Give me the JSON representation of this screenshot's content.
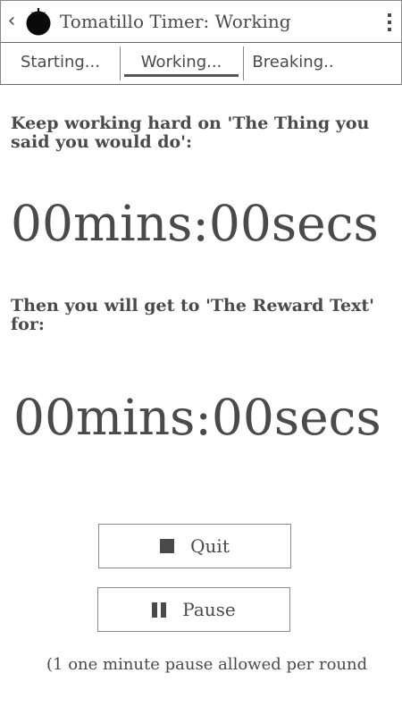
{
  "header": {
    "title": "Tomatillo Timer: Working",
    "back_icon": "chevron-left-icon",
    "logo_icon": "tomato-icon",
    "menu_icon": "overflow-menu-icon"
  },
  "tabs": [
    {
      "label": "Starting..."
    },
    {
      "label": "Working...",
      "active": true
    },
    {
      "label": "Breaking.."
    }
  ],
  "main": {
    "work_prompt": "Keep working hard on 'The Thing you said you would do':",
    "work_timer": "00mins:00secs",
    "reward_prompt": "Then you will get to 'The Reward Text' for:",
    "reward_timer": "00mins:00secs"
  },
  "buttons": {
    "quit_label": "Quit",
    "quit_icon": "stop-icon",
    "pause_label": "Pause",
    "pause_icon": "pause-icon"
  },
  "footer": {
    "note": "(1 one minute pause allowed per round"
  },
  "colors": {
    "text": "#4a4a4a",
    "border": "#8a8a8a",
    "background": "#ffffff"
  }
}
